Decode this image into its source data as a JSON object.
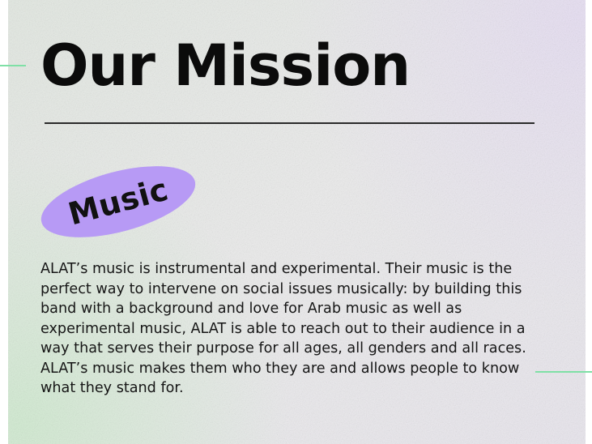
{
  "slide": {
    "title": "Our Mission",
    "tag": "Music",
    "body": "ALAT’s music is instrumental and experimental. Their music is the perfect way to intervene on social issues musically: by building this band with a background and love for Arab music as well as experimental music, ALAT is able to reach out to their audience in a way that serves their purpose for all ages, all genders and all races. ALAT’s music makes them who they are and allows people to know what they stand for."
  },
  "colors": {
    "pill": "#b79af5",
    "accent": "#7fe0a6",
    "text": "#111111"
  }
}
